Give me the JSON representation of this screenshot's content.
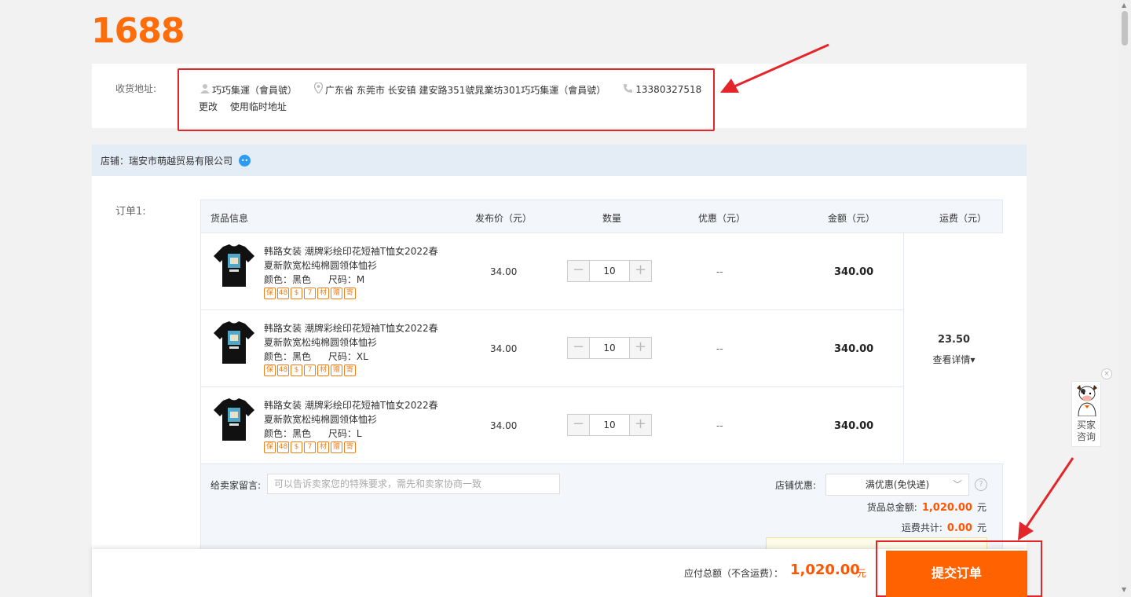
{
  "brand": {
    "logo_text": "1688",
    "accent": "#ff6d0a",
    "annotation_color": "#e4262b"
  },
  "address": {
    "label": "收货地址:",
    "name": "巧巧集運（會員號）",
    "location": "广东省 东莞市 长安镇 建安路351號晁業坊301巧巧集運（會員號）",
    "phone": "13380327518",
    "change_link": "更改",
    "temp_address_link": "使用临时地址",
    "user_icon": "user-icon",
    "location_icon": "location-pin-icon",
    "phone_icon": "phone-icon"
  },
  "shop": {
    "label": "店铺：",
    "name": "瑞安市萌越贸易有限公司",
    "chat_icon": "wangwang-chat-icon"
  },
  "order": {
    "label": "订单1:",
    "columns": [
      "货品信息",
      "发布价（元）",
      "数量",
      "优惠（元）",
      "金额（元）",
      "运费（元）"
    ],
    "items": [
      {
        "title": "韩路女装 潮牌彩绘印花短袖T恤女2022春夏新款宽松纯棉圆领体恤衫",
        "color_label": "颜色：",
        "color": "黑色",
        "size_label": "尺码：",
        "size": "M",
        "price": "34.00",
        "qty": "10",
        "promo": "--",
        "amount": "340.00"
      },
      {
        "title": "韩路女装 潮牌彩绘印花短袖T恤女2022春夏新款宽松纯棉圆领体恤衫",
        "color_label": "颜色：",
        "color": "黑色",
        "size_label": "尺码：",
        "size": "XL",
        "price": "34.00",
        "qty": "10",
        "promo": "--",
        "amount": "340.00"
      },
      {
        "title": "韩路女装 潮牌彩绘印花短袖T恤女2022春夏新款宽松纯棉圆领体恤衫",
        "color_label": "颜色：",
        "color": "黑色",
        "size_label": "尺码：",
        "size": "L",
        "price": "34.00",
        "qty": "10",
        "promo": "--",
        "amount": "340.00"
      }
    ],
    "service_tags": [
      "保",
      "48",
      "$",
      "7",
      "材",
      "赠",
      "寄"
    ],
    "shipping": {
      "value": "23.50",
      "detail": "查看详情▾"
    },
    "message_label": "给卖家留言:",
    "message_placeholder": "可以告诉卖家您的特殊要求，需先和卖家协商一致",
    "shop_discount_label": "店铺优惠:",
    "shop_discount_value": "满优惠(免快递)",
    "goods_total_label": "货品总金额:",
    "goods_total": "1,020.00",
    "shipping_total_label": "运费共计:",
    "shipping_total": "0.00",
    "currency_unit": "元"
  },
  "footer": {
    "total_label": "应付总额（不含运费）：",
    "total": "1,020.00",
    "unit": "元",
    "submit": "提交订单"
  },
  "consult": {
    "line1": "买家",
    "line2": "咨询",
    "close": "×"
  },
  "stepper": {
    "minus": "−",
    "plus": "+"
  },
  "help": "?"
}
